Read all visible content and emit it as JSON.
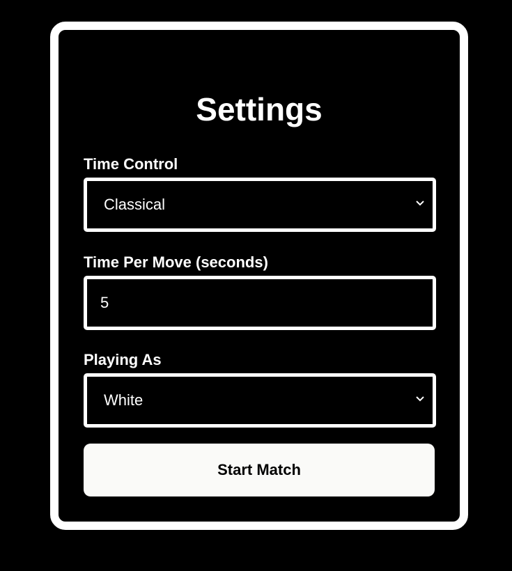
{
  "settings": {
    "title": "Settings",
    "time_control": {
      "label": "Time Control",
      "value": "Classical",
      "icon": "chevron-down-icon"
    },
    "time_per_move": {
      "label": "Time Per Move (seconds)",
      "value": "5"
    },
    "playing_as": {
      "label": "Playing As",
      "value": "White",
      "icon": "chevron-down-icon"
    },
    "start_button_label": "Start Match"
  },
  "colors": {
    "background": "#000000",
    "foreground": "#ffffff",
    "button_background": "#fafaf8",
    "button_text": "#000000"
  }
}
